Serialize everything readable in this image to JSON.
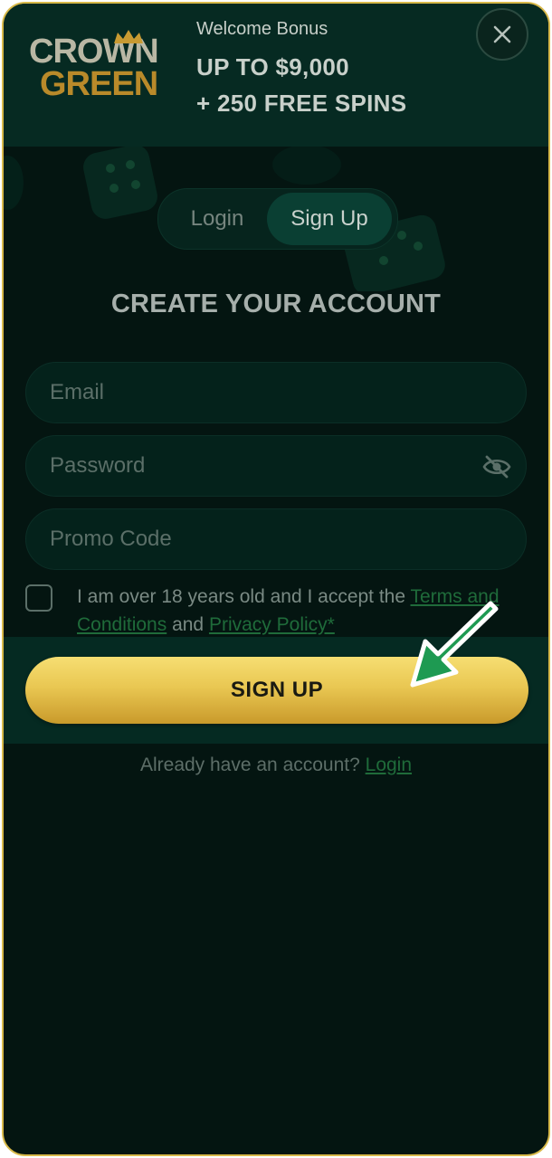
{
  "logo": {
    "line1": "CROWN",
    "line2": "GREEN"
  },
  "header": {
    "bonus_label": "Welcome Bonus",
    "bonus_line1": "UP TO $9,000",
    "bonus_line2": "+ 250 FREE SPINS",
    "close_icon": "close-icon"
  },
  "tabs": [
    {
      "label": "Login",
      "active": false
    },
    {
      "label": "Sign Up",
      "active": true
    }
  ],
  "title": "CREATE YOUR ACCOUNT",
  "form": {
    "email_placeholder": "Email",
    "password_placeholder": "Password",
    "password_icon": "eye-slash-icon",
    "promo_placeholder": "Promo Code",
    "terms_prefix": "I am over 18 years old and I accept the ",
    "terms_link": "Terms and Conditions",
    "terms_and": " and ",
    "privacy_link": "Privacy Policy*",
    "submit_label": "SIGN UP"
  },
  "footer": {
    "prompt": "Already have an account? ",
    "login_link": "Login"
  },
  "colors": {
    "frame_border": "#d8b94a",
    "background": "#041511",
    "header_bg": "#062a22",
    "button_gold": "#e9c752",
    "link_green": "#1f6b3a",
    "arrow_green": "#1e9a52"
  }
}
